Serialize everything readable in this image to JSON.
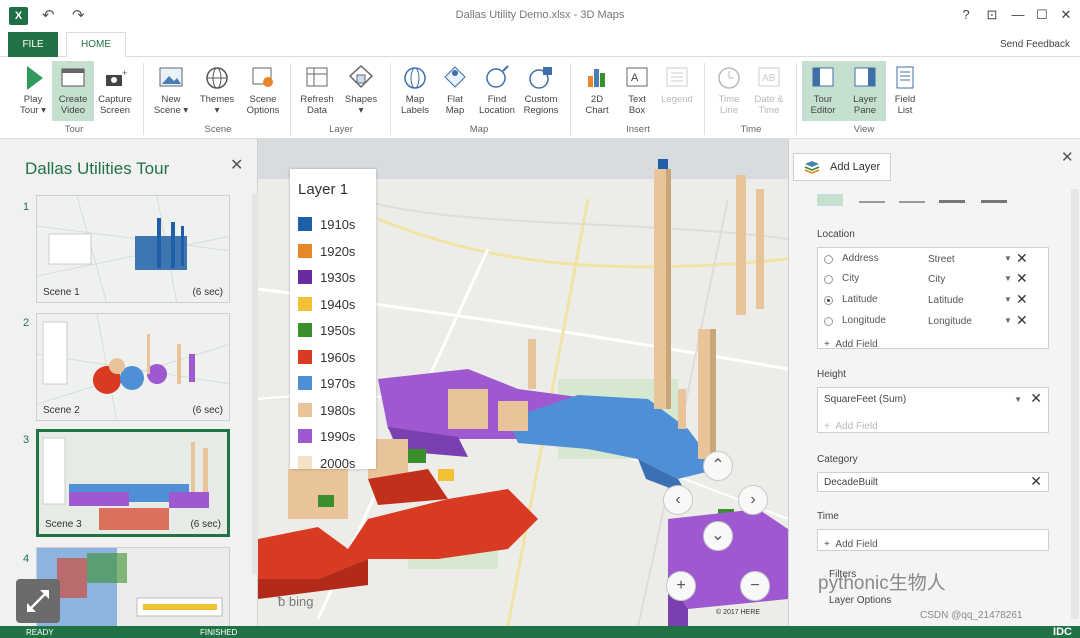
{
  "window": {
    "title": "Dallas Utility Demo.xlsx - 3D Maps",
    "controls": [
      "?",
      "⊡",
      "—",
      "☐",
      "✕"
    ]
  },
  "quick_access": {
    "undo_icon": "undo-icon",
    "redo_icon": "redo-icon"
  },
  "tabs": {
    "file": "FILE",
    "home": "HOME"
  },
  "send_feedback": "Send Feedback",
  "ribbon": {
    "groups": {
      "tour": "Tour",
      "scene": "Scene",
      "layer": "Layer",
      "map": "Map",
      "insert": "Insert",
      "time": "Time",
      "view": "View"
    },
    "buttons": {
      "play_tour": "Play\nTour ▾",
      "create_video": "Create\nVideo",
      "capture_screen": "Capture\nScreen",
      "new_scene": "New\nScene ▾",
      "themes": "Themes\n▾",
      "scene_options": "Scene\nOptions",
      "refresh_data": "Refresh\nData",
      "shapes": "Shapes\n▾",
      "map_labels": "Map\nLabels",
      "flat_map": "Flat\nMap",
      "find_location": "Find\nLocation",
      "custom_regions": "Custom\nRegions",
      "chart_2d": "2D\nChart",
      "text_box": "Text\nBox",
      "legend": "Legend",
      "time_line": "Time\nLine",
      "date_time": "Date &\nTime",
      "tour_editor": "Tour\nEditor",
      "layer_pane": "Layer\nPane",
      "field_list": "Field\nList"
    }
  },
  "tour": {
    "title": "Dallas Utilities Tour",
    "scenes": [
      {
        "num": "1",
        "name": "Scene 1",
        "duration": "(6 sec)"
      },
      {
        "num": "2",
        "name": "Scene 2",
        "duration": "(6 sec)"
      },
      {
        "num": "3",
        "name": "Scene 3",
        "duration": "(6 sec)"
      },
      {
        "num": "4",
        "name": "",
        "duration": ""
      }
    ]
  },
  "map": {
    "legend": {
      "title": "Layer 1",
      "items": [
        {
          "label": "1910s",
          "color": "#1f5fa8"
        },
        {
          "label": "1920s",
          "color": "#e8872a"
        },
        {
          "label": "1930s",
          "color": "#6a2aa0"
        },
        {
          "label": "1940s",
          "color": "#f2c034"
        },
        {
          "label": "1950s",
          "color": "#3a8f2c"
        },
        {
          "label": "1960s",
          "color": "#d83a22"
        },
        {
          "label": "1970s",
          "color": "#4f8fd6"
        },
        {
          "label": "1980s",
          "color": "#e9c49b"
        },
        {
          "label": "1990s",
          "color": "#9f59d0"
        },
        {
          "label": "2000s",
          "color": "#f3e2c5"
        }
      ]
    },
    "bing": "bing",
    "copyright": "© 2017 HERE"
  },
  "layer_pane": {
    "add_layer": "Add Layer",
    "location_label": "Location",
    "location_rows": [
      {
        "name": "Address",
        "type": "Street",
        "selected": false
      },
      {
        "name": "City",
        "type": "City",
        "selected": false
      },
      {
        "name": "Latitude",
        "type": "Latitude",
        "selected": true
      },
      {
        "name": "Longitude",
        "type": "Longitude",
        "selected": false
      }
    ],
    "add_field": "Add Field",
    "height_label": "Height",
    "height_value": "SquareFeet (Sum)",
    "category_label": "Category",
    "category_value": "DecadeBuilt",
    "time_label": "Time",
    "filters_label": "Filters",
    "layer_options_label": "Layer Options"
  },
  "status": {
    "left": "READY",
    "mid": "FINISHED",
    "right": "IDC"
  },
  "watermark": {
    "main": "pythonic生物人",
    "sub": "CSDN @qq_21478261"
  }
}
